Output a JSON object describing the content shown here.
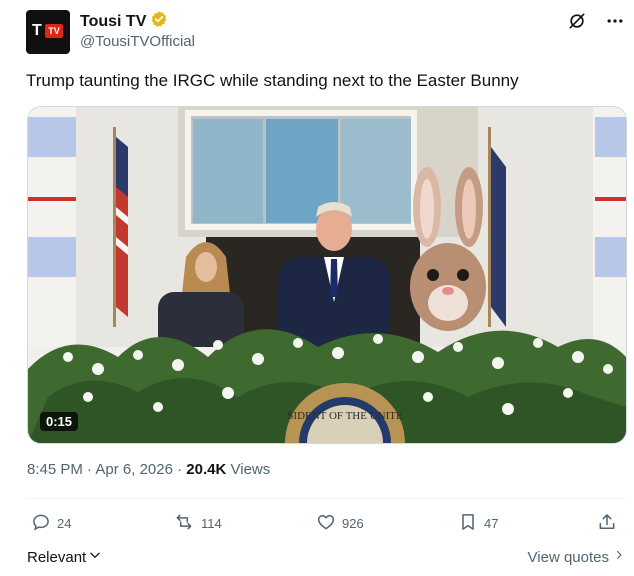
{
  "author": {
    "display_name": "Tousi TV",
    "handle": "@TousiTVOfficial",
    "avatar_text": "TV",
    "verified_color": "#e2b719"
  },
  "header_actions": {
    "grok_icon": "grok-icon",
    "more_icon": "more-icon"
  },
  "tweet": {
    "text": "Trump taunting the IRGC while standing next to the Easter Bunny"
  },
  "media": {
    "duration": "0:15",
    "seal_text": "SIDENT OF THE UNITE"
  },
  "meta": {
    "time": "8:45 PM",
    "date": "Apr 6, 2026",
    "views_count": "20.4K",
    "views_label": "Views",
    "separator": "·"
  },
  "actions": {
    "replies": "24",
    "reposts": "114",
    "likes": "926",
    "bookmarks": "47"
  },
  "footer": {
    "relevant_label": "Relevant",
    "view_quotes_label": "View quotes"
  }
}
